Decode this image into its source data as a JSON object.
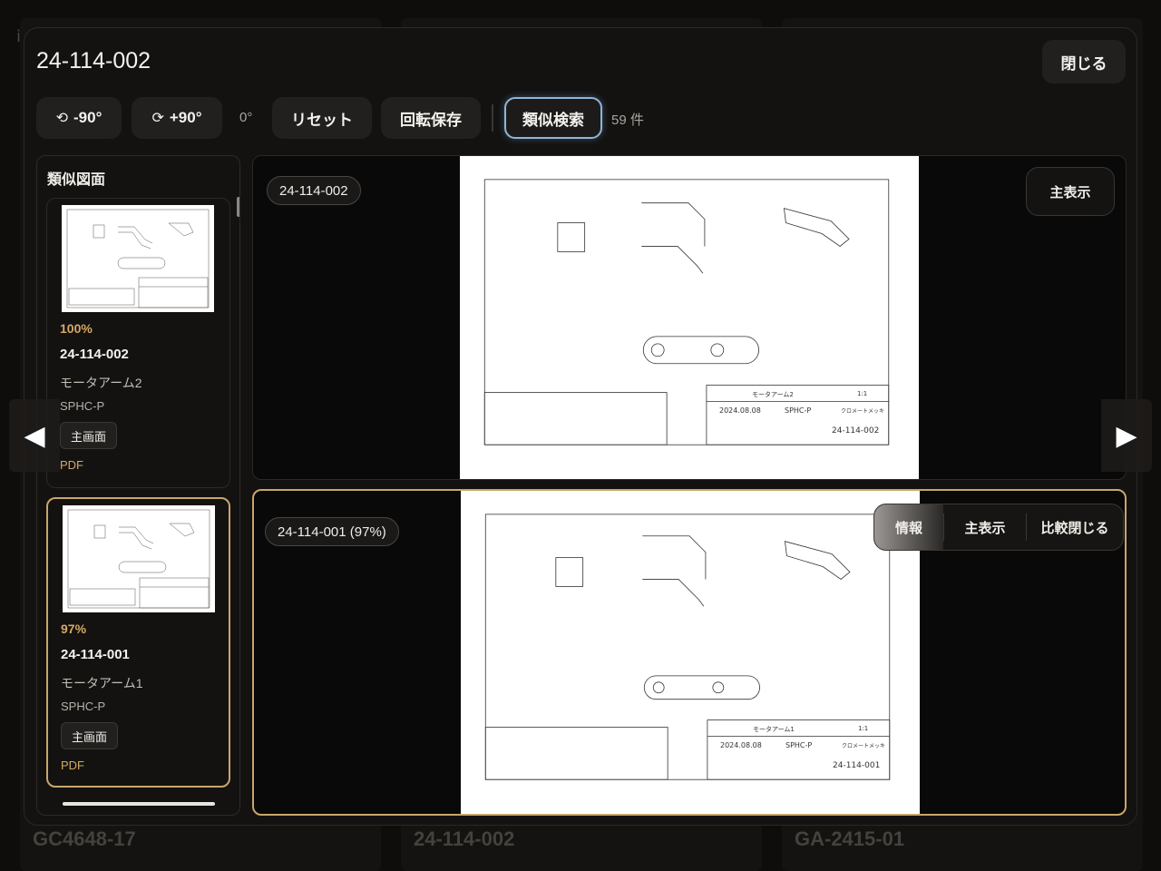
{
  "background": {
    "corner_letter": "i",
    "cards": [
      "GC4648-17",
      "24-114-002",
      "GA-2415-01"
    ]
  },
  "modal": {
    "title": "24-114-002",
    "close_label": "閉じる"
  },
  "toolbar": {
    "rotate_left_label": "-90°",
    "rotate_right_label": "+90°",
    "angle": "0°",
    "reset_label": "リセット",
    "save_rotation_label": "回転保存",
    "similar_search_label": "類似検索",
    "result_count": "59 件"
  },
  "sidebar": {
    "title": "類似図面",
    "items": [
      {
        "score": "100%",
        "id": "24-114-002",
        "name": "モータアーム2",
        "material": "SPHC-P",
        "main_button": "主画面",
        "pdf": "PDF"
      },
      {
        "score": "97%",
        "id": "24-114-001",
        "name": "モータアーム1",
        "material": "SPHC-P",
        "main_button": "主画面",
        "pdf": "PDF"
      }
    ]
  },
  "viewer_top": {
    "label": "24-114-002",
    "main_display_label": "主表示",
    "drawing": {
      "part_name": "モータアーム2",
      "material": "SPHC-P",
      "date": "2024.08.08",
      "scale": "1:1",
      "drawing_no": "24-114-002",
      "finish": "クロメートメッキ"
    }
  },
  "viewer_bottom": {
    "label": "24-114-001 (97%)",
    "info_label": "情報",
    "main_display_label": "主表示",
    "close_compare_label": "比較閉じる",
    "drawing": {
      "part_name": "モータアーム1",
      "material": "SPHC-P",
      "date": "2024.08.08",
      "scale": "1:1",
      "drawing_no": "24-114-001",
      "finish": "クロメートメッキ"
    }
  },
  "icons": {
    "rotate_left": "rotate-left-icon",
    "rotate_right": "rotate-right-icon",
    "prev": "chevron-left-icon",
    "next": "chevron-right-icon"
  },
  "colors": {
    "accent_gold": "#c9a66b",
    "score_gold": "#d6a866",
    "active_blue": "#8fb5d8",
    "panel": "#131211"
  }
}
